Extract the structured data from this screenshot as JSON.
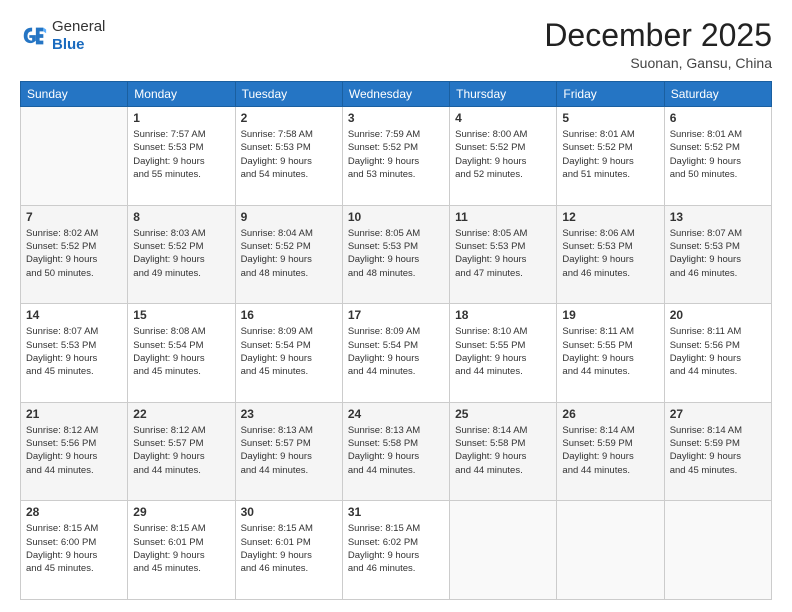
{
  "header": {
    "logo_general": "General",
    "logo_blue": "Blue",
    "month_year": "December 2025",
    "location": "Suonan, Gansu, China"
  },
  "days_of_week": [
    "Sunday",
    "Monday",
    "Tuesday",
    "Wednesday",
    "Thursday",
    "Friday",
    "Saturday"
  ],
  "weeks": [
    [
      {
        "num": "",
        "info": ""
      },
      {
        "num": "1",
        "info": "Sunrise: 7:57 AM\nSunset: 5:53 PM\nDaylight: 9 hours\nand 55 minutes."
      },
      {
        "num": "2",
        "info": "Sunrise: 7:58 AM\nSunset: 5:53 PM\nDaylight: 9 hours\nand 54 minutes."
      },
      {
        "num": "3",
        "info": "Sunrise: 7:59 AM\nSunset: 5:52 PM\nDaylight: 9 hours\nand 53 minutes."
      },
      {
        "num": "4",
        "info": "Sunrise: 8:00 AM\nSunset: 5:52 PM\nDaylight: 9 hours\nand 52 minutes."
      },
      {
        "num": "5",
        "info": "Sunrise: 8:01 AM\nSunset: 5:52 PM\nDaylight: 9 hours\nand 51 minutes."
      },
      {
        "num": "6",
        "info": "Sunrise: 8:01 AM\nSunset: 5:52 PM\nDaylight: 9 hours\nand 50 minutes."
      }
    ],
    [
      {
        "num": "7",
        "info": "Sunrise: 8:02 AM\nSunset: 5:52 PM\nDaylight: 9 hours\nand 50 minutes."
      },
      {
        "num": "8",
        "info": "Sunrise: 8:03 AM\nSunset: 5:52 PM\nDaylight: 9 hours\nand 49 minutes."
      },
      {
        "num": "9",
        "info": "Sunrise: 8:04 AM\nSunset: 5:52 PM\nDaylight: 9 hours\nand 48 minutes."
      },
      {
        "num": "10",
        "info": "Sunrise: 8:05 AM\nSunset: 5:53 PM\nDaylight: 9 hours\nand 48 minutes."
      },
      {
        "num": "11",
        "info": "Sunrise: 8:05 AM\nSunset: 5:53 PM\nDaylight: 9 hours\nand 47 minutes."
      },
      {
        "num": "12",
        "info": "Sunrise: 8:06 AM\nSunset: 5:53 PM\nDaylight: 9 hours\nand 46 minutes."
      },
      {
        "num": "13",
        "info": "Sunrise: 8:07 AM\nSunset: 5:53 PM\nDaylight: 9 hours\nand 46 minutes."
      }
    ],
    [
      {
        "num": "14",
        "info": "Sunrise: 8:07 AM\nSunset: 5:53 PM\nDaylight: 9 hours\nand 45 minutes."
      },
      {
        "num": "15",
        "info": "Sunrise: 8:08 AM\nSunset: 5:54 PM\nDaylight: 9 hours\nand 45 minutes."
      },
      {
        "num": "16",
        "info": "Sunrise: 8:09 AM\nSunset: 5:54 PM\nDaylight: 9 hours\nand 45 minutes."
      },
      {
        "num": "17",
        "info": "Sunrise: 8:09 AM\nSunset: 5:54 PM\nDaylight: 9 hours\nand 44 minutes."
      },
      {
        "num": "18",
        "info": "Sunrise: 8:10 AM\nSunset: 5:55 PM\nDaylight: 9 hours\nand 44 minutes."
      },
      {
        "num": "19",
        "info": "Sunrise: 8:11 AM\nSunset: 5:55 PM\nDaylight: 9 hours\nand 44 minutes."
      },
      {
        "num": "20",
        "info": "Sunrise: 8:11 AM\nSunset: 5:56 PM\nDaylight: 9 hours\nand 44 minutes."
      }
    ],
    [
      {
        "num": "21",
        "info": "Sunrise: 8:12 AM\nSunset: 5:56 PM\nDaylight: 9 hours\nand 44 minutes."
      },
      {
        "num": "22",
        "info": "Sunrise: 8:12 AM\nSunset: 5:57 PM\nDaylight: 9 hours\nand 44 minutes."
      },
      {
        "num": "23",
        "info": "Sunrise: 8:13 AM\nSunset: 5:57 PM\nDaylight: 9 hours\nand 44 minutes."
      },
      {
        "num": "24",
        "info": "Sunrise: 8:13 AM\nSunset: 5:58 PM\nDaylight: 9 hours\nand 44 minutes."
      },
      {
        "num": "25",
        "info": "Sunrise: 8:14 AM\nSunset: 5:58 PM\nDaylight: 9 hours\nand 44 minutes."
      },
      {
        "num": "26",
        "info": "Sunrise: 8:14 AM\nSunset: 5:59 PM\nDaylight: 9 hours\nand 44 minutes."
      },
      {
        "num": "27",
        "info": "Sunrise: 8:14 AM\nSunset: 5:59 PM\nDaylight: 9 hours\nand 45 minutes."
      }
    ],
    [
      {
        "num": "28",
        "info": "Sunrise: 8:15 AM\nSunset: 6:00 PM\nDaylight: 9 hours\nand 45 minutes."
      },
      {
        "num": "29",
        "info": "Sunrise: 8:15 AM\nSunset: 6:01 PM\nDaylight: 9 hours\nand 45 minutes."
      },
      {
        "num": "30",
        "info": "Sunrise: 8:15 AM\nSunset: 6:01 PM\nDaylight: 9 hours\nand 46 minutes."
      },
      {
        "num": "31",
        "info": "Sunrise: 8:15 AM\nSunset: 6:02 PM\nDaylight: 9 hours\nand 46 minutes."
      },
      {
        "num": "",
        "info": ""
      },
      {
        "num": "",
        "info": ""
      },
      {
        "num": "",
        "info": ""
      }
    ]
  ]
}
